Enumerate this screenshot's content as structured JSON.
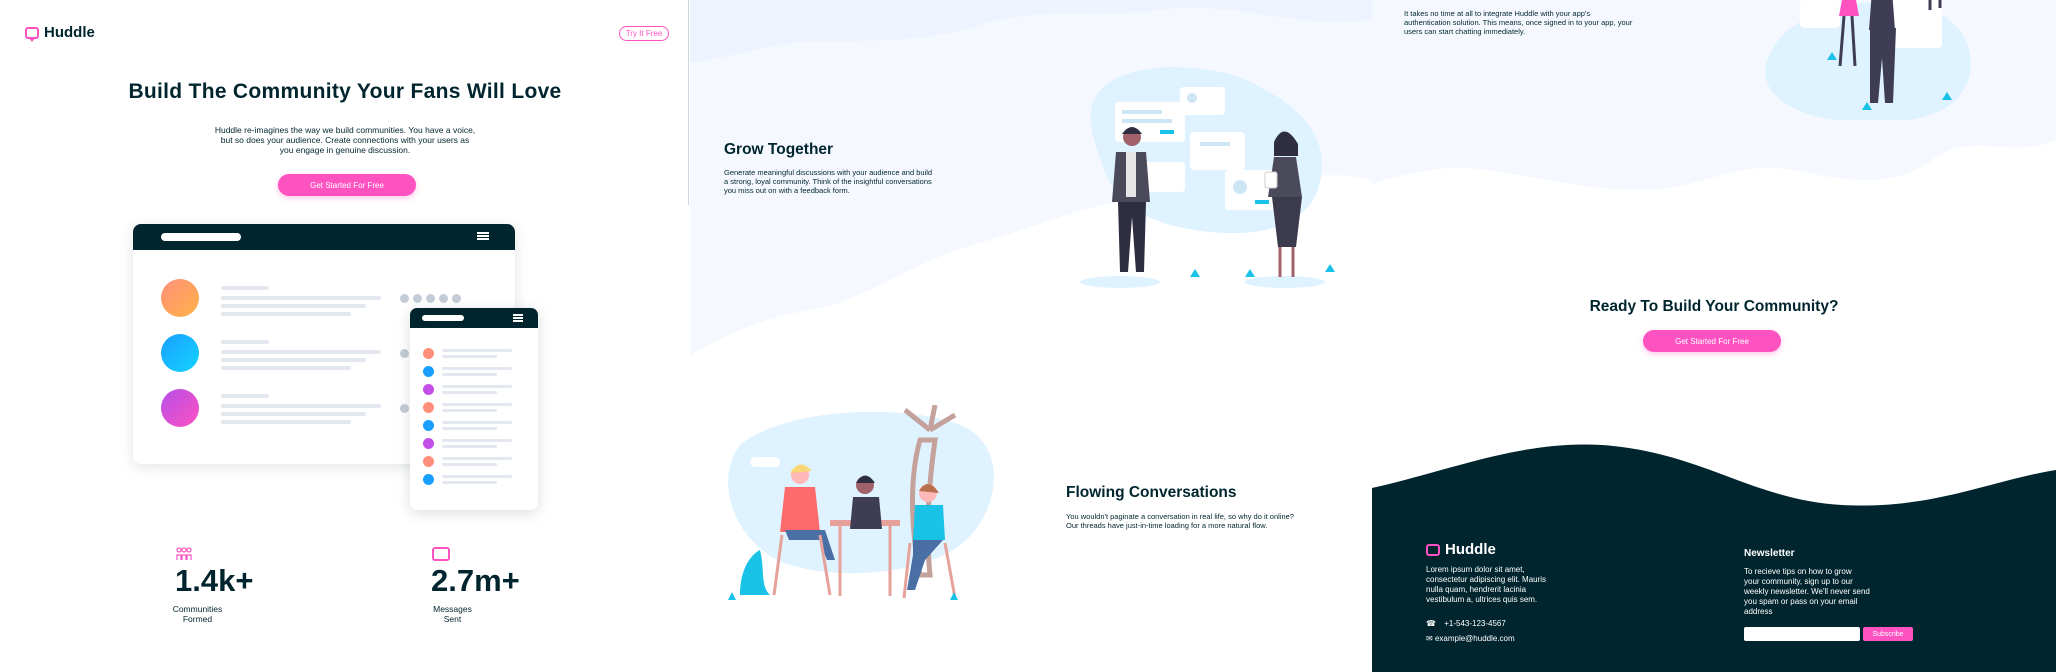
{
  "brand": {
    "name": "Huddle",
    "accent": "#ff52c1",
    "dark": "#00252e"
  },
  "header": {
    "try_button": "Try It Free"
  },
  "hero": {
    "title": "Build The Community Your Fans Will Love",
    "desc_lines": [
      "Huddle re-imagines the way we build communities. You have a voice,",
      "but so does your audience. Create connections with your users as",
      "you engage in genuine discussion."
    ],
    "cta": "Get Started For Free"
  },
  "stats": [
    {
      "number": "1.4k+",
      "label_lines": [
        "Communities",
        "Formed"
      ],
      "icon": "communities-icon"
    },
    {
      "number": "2.7m+",
      "label_lines": [
        "Messages",
        "Sent"
      ],
      "icon": "messages-icon"
    }
  ],
  "features": {
    "top_partial_lines": [
      "It takes no time at all to integrate Huddle with your app's",
      "authentication solution. This means, once signed in to your app, your",
      "users can start chatting immediately."
    ],
    "grow": {
      "title": "Grow Together",
      "lines": [
        "Generate meaningful discussions with your audience and build",
        "a strong, loyal community. Think of the insightful conversations",
        "you miss out on with a feedback form."
      ]
    },
    "flowing": {
      "title": "Flowing Conversations",
      "lines": [
        "You wouldn't paginate a conversation in real life, so why do it online?",
        "Our threads have just-in-time loading for a more natural flow."
      ]
    }
  },
  "cta_section": {
    "title": "Ready To Build Your Community?",
    "button": "Get Started For Free"
  },
  "footer": {
    "desc_lines": [
      "Lorem ipsum dolor sit amet,",
      "consectetur adipiscing elit. Mauris",
      "nulla quam, hendrerit lacinia",
      "vestibulum a, ultrices quis sem."
    ],
    "phone": "+1-543-123-4567",
    "email": "example@huddle.com",
    "newsletter": {
      "title": "Newsletter",
      "desc_lines": [
        "To recieve tips on how to grow",
        "your community, sign up to our",
        "weekly newsletter. We'll never send",
        "you spam or pass on your email",
        "address"
      ],
      "button": "Subscribe"
    }
  }
}
